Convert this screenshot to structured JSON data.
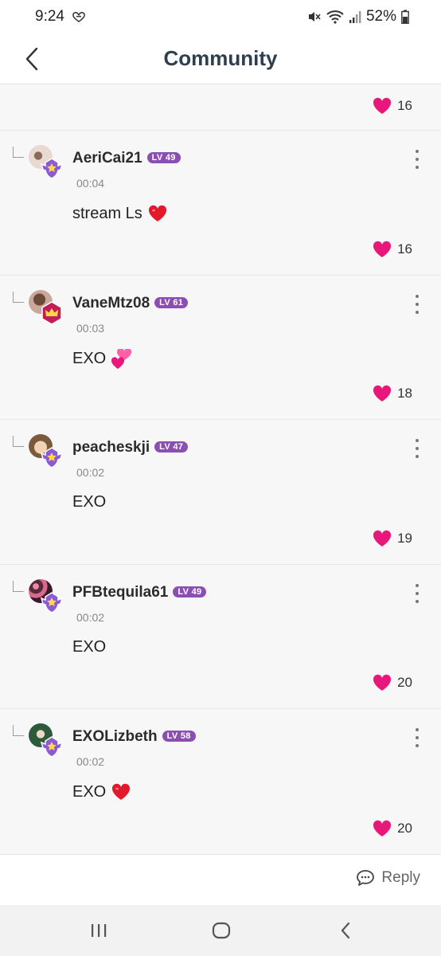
{
  "status_bar": {
    "time": "9:24",
    "battery_percent": "52%"
  },
  "header": {
    "title": "Community"
  },
  "top_like": {
    "count": "16"
  },
  "comments": [
    {
      "username": "AeriCai21",
      "level": "LV 49",
      "time": "00:04",
      "text": "stream Ls",
      "emoji": "red-heart",
      "likes": "16",
      "badge": "star-shield"
    },
    {
      "username": "VaneMtz08",
      "level": "LV 61",
      "time": "00:03",
      "text": "EXO",
      "emoji": "two-hearts",
      "likes": "18",
      "badge": "crown-hexagon"
    },
    {
      "username": "peacheskji",
      "level": "LV 47",
      "time": "00:02",
      "text": "EXO",
      "emoji": "",
      "likes": "19",
      "badge": "star-shield"
    },
    {
      "username": "PFBtequila61",
      "level": "LV 49",
      "time": "00:02",
      "text": "EXO",
      "emoji": "",
      "likes": "20",
      "badge": "star-shield"
    },
    {
      "username": "EXOLizbeth",
      "level": "LV 58",
      "time": "00:02",
      "text": "EXO",
      "emoji": "red-heart",
      "likes": "20",
      "badge": "star-shield"
    }
  ],
  "reply_bar": {
    "label": "Reply"
  },
  "colors": {
    "like_pink": "#e8177a",
    "level_purple": "#8a4fb0",
    "title": "#2e3e4e",
    "badge_purple": "#8b5bd6",
    "badge_crimson": "#c21d59"
  }
}
